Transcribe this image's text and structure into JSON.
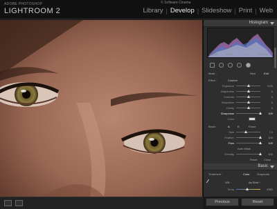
{
  "app": {
    "brand_sub": "ADOBE PHOTOSHOP",
    "brand_main": "LIGHTROOM 2",
    "copyright": "© Software Cinema"
  },
  "modules": [
    {
      "label": "Library",
      "active": false
    },
    {
      "label": "Develop",
      "active": true
    },
    {
      "label": "Slideshow",
      "active": false
    },
    {
      "label": "Print",
      "active": false
    },
    {
      "label": "Web",
      "active": false
    }
  ],
  "panel": {
    "histogram_title": "Histogram",
    "histogram_info": [
      "ISO 200",
      "50mm",
      "f / 5.0",
      "1/125 sec"
    ],
    "mask_row": {
      "left": "Mask :",
      "mid": "New",
      "right": "Edit"
    },
    "effect_row": {
      "left": "Effect :",
      "mid": "Custom"
    },
    "sliders_top": [
      {
        "label": "Exposure",
        "value": "0.00",
        "pos": 50
      },
      {
        "label": "Brightness",
        "value": "0",
        "pos": 50
      },
      {
        "label": "Contrast",
        "value": "0",
        "pos": 50
      },
      {
        "label": "Saturation",
        "value": "0",
        "pos": 50
      },
      {
        "label": "Clarity",
        "value": "0",
        "pos": 50
      },
      {
        "label": "Sharpness",
        "value": "100",
        "pos": 100,
        "highlight": true
      },
      {
        "label": "Color",
        "value": "",
        "pos": 70
      }
    ],
    "brush_row": {
      "left": "Brush :",
      "a": "A",
      "b": "B",
      "c": "Erase"
    },
    "sliders_bottom": [
      {
        "label": "Size",
        "value": "7.0",
        "pos": 40
      },
      {
        "label": "Feather",
        "value": "100",
        "pos": 100
      },
      {
        "label": "Flow",
        "value": "100",
        "pos": 100
      },
      {
        "label": "Auto Mask",
        "value": "",
        "pos": 0
      },
      {
        "label": "Density",
        "value": "100",
        "pos": 100
      }
    ],
    "reset_row": {
      "left": "Reset",
      "right": "Close"
    },
    "basic_title": "Basic",
    "treatment": {
      "label": "Treatment :",
      "color": "Color",
      "gray": "Grayscale"
    },
    "wb": {
      "label": "WB :",
      "value": "As Shot ÷"
    },
    "temp": {
      "label": "Temp",
      "value": "4350"
    },
    "previous_button": "Previous",
    "reset_button": "Reset"
  },
  "colors": {
    "accent": "#e8e8e8",
    "panel_bg": "#2e2e2e",
    "photo_skin": "#9c6a55"
  }
}
